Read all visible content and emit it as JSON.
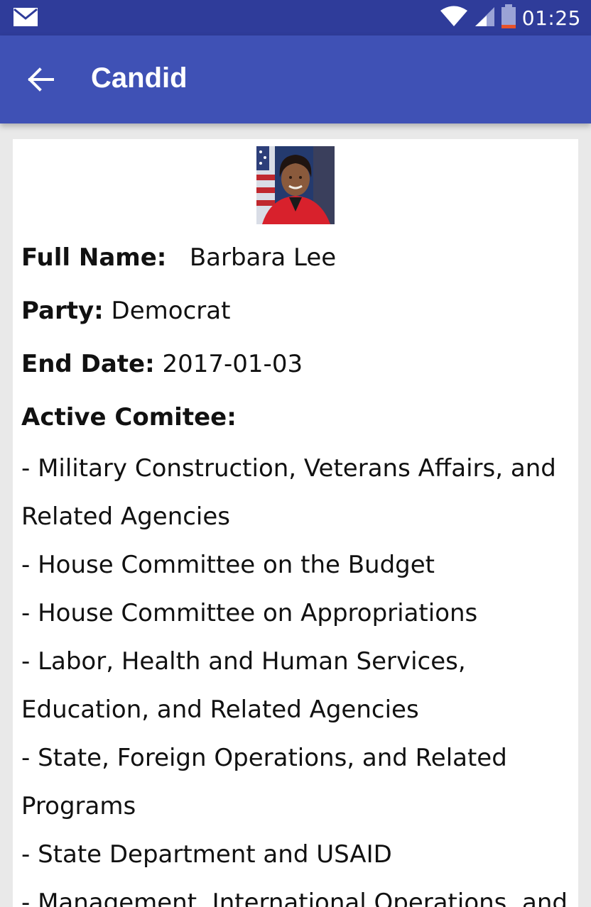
{
  "status_bar": {
    "time": "01:25",
    "icons": [
      "mail-icon",
      "wifi-icon",
      "signal-icon",
      "battery-icon"
    ]
  },
  "app_bar": {
    "title": "Candid",
    "back_icon": "arrow-left-icon"
  },
  "profile": {
    "full_name_label": "Full Name:",
    "full_name": "Barbara Lee",
    "party_label": "Party:",
    "party": "Democrat",
    "end_date_label": "End Date:",
    "end_date": "2017-01-03",
    "committee_label": "Active Comitee:",
    "committees": [
      "- Military Construction, Veterans Affairs, and Related Agencies",
      "- House Committee on the Budget",
      "- House Committee on Appropriations",
      "- Labor, Health and Human Services, Education, and Related Agencies",
      "- State, Foreign Operations, and Related Programs",
      "- State Department and USAID",
      "- Management, International Operations, and"
    ]
  },
  "colors": {
    "status_bar": "#2f3c9a",
    "app_bar": "#3f51b5",
    "background": "#e9e9e9",
    "card": "#ffffff"
  }
}
